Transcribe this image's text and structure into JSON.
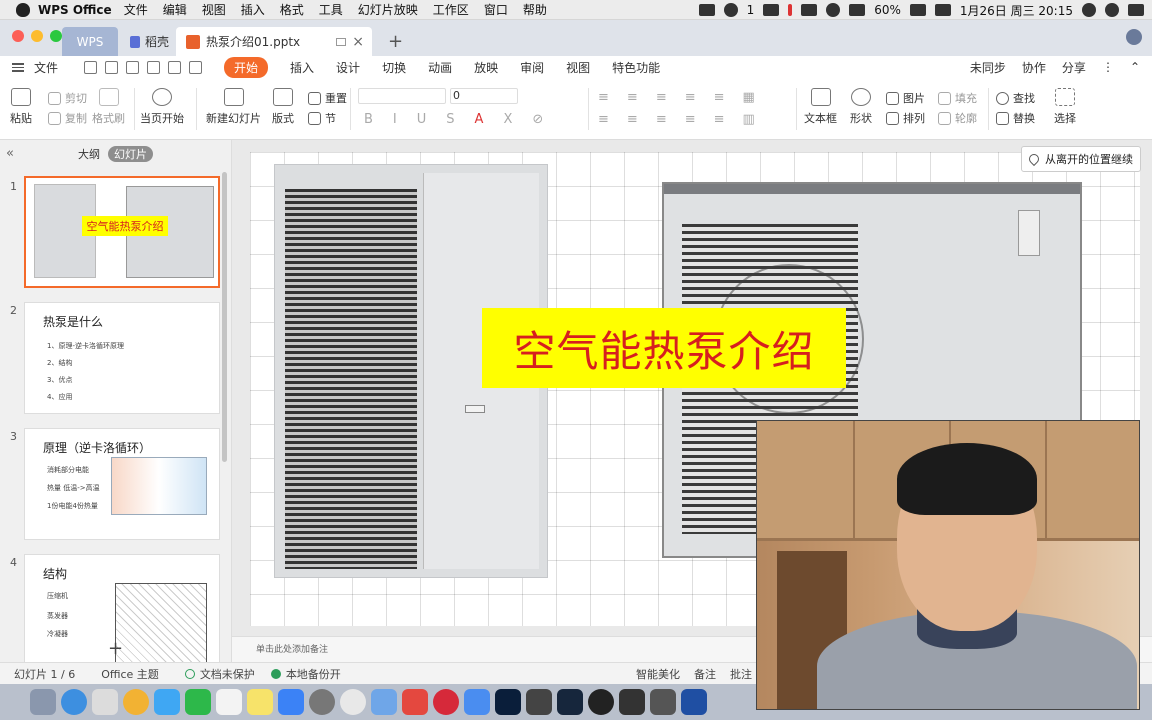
{
  "menubar": {
    "app_name": "WPS Office",
    "items": [
      "文件",
      "编辑",
      "视图",
      "插入",
      "格式",
      "工具",
      "幻灯片放映",
      "工作区",
      "窗口",
      "帮助"
    ],
    "wechat_count": "1",
    "battery": "60%",
    "datetime": "1月26日 周三  20:15"
  },
  "tabs": {
    "wps": "WPS",
    "daoke": "稻壳",
    "file": "热泵介绍01.pptx",
    "close": "×",
    "add": "+"
  },
  "ribbon": {
    "file": "文件",
    "tabs": [
      "开始",
      "插入",
      "设计",
      "切换",
      "动画",
      "放映",
      "审阅",
      "视图",
      "特色功能"
    ],
    "active_tab": "开始",
    "right": [
      "未同步",
      "协作",
      "分享"
    ]
  },
  "toolbar": {
    "paste": "粘贴",
    "cut": "剪切",
    "copy": "复制",
    "format_painter": "格式刷",
    "play_current": "当页开始",
    "new_slide": "新建幻灯片",
    "layout": "版式",
    "reset": "重置",
    "section": "节",
    "font_size": "0",
    "textbox": "文本框",
    "shape": "形状",
    "picture": "图片",
    "arrange": "排列",
    "fill": "填充",
    "outline": "轮廓",
    "find": "查找",
    "replace": "替换",
    "select": "选择"
  },
  "left_panel": {
    "outline_tab": "大纲",
    "slides_tab": "幻灯片",
    "collapse": "«",
    "slides": [
      {
        "num": "1",
        "title": "空气能热泵介绍"
      },
      {
        "num": "2",
        "title": "热泵是什么",
        "lines": [
          "1、原理-逆卡洛循环原理",
          "2、结构",
          "3、优点",
          "4、应用"
        ]
      },
      {
        "num": "3",
        "title": "原理（逆卡洛循环）",
        "lines": [
          "消耗部分电能",
          "热量 低温->高温",
          "1份电能4份热量"
        ]
      },
      {
        "num": "4",
        "title": "结构",
        "lines": [
          "压缩机",
          "蒸发器",
          "冷凝器"
        ]
      }
    ],
    "add": "+"
  },
  "slide": {
    "title": "空气能热泵介绍",
    "resume": "从离开的位置继续"
  },
  "notes_placeholder": "单击此处添加备注",
  "statusbar": {
    "slide_count": "幻灯片 1 / 6",
    "theme": "Office 主题",
    "protect": "文档未保护",
    "backup": "本地备份开",
    "beautify": "智能美化",
    "notes": "备注",
    "comments": "批注"
  },
  "colors": {
    "accent": "#f46a2a",
    "title_bg": "#ffff00",
    "title_text": "#d61f1f"
  }
}
